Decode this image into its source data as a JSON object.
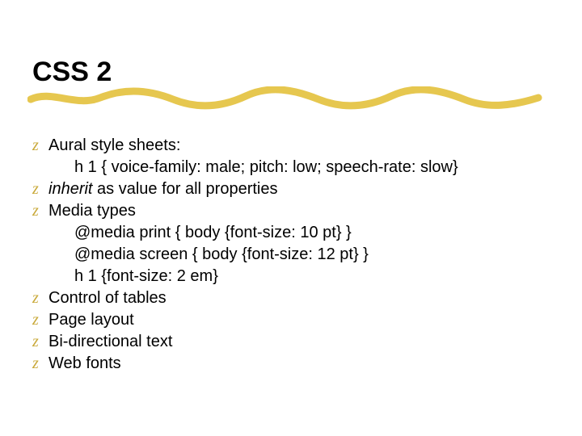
{
  "title": "CSS 2",
  "bullet_glyph": "z",
  "items": [
    {
      "text": "Aural style sheets:",
      "sub": [
        "h 1 { voice-family: male; pitch: low; speech-rate: slow}"
      ]
    },
    {
      "prefix_italic": "inherit",
      "rest": " as value for all properties"
    },
    {
      "text": "Media types",
      "sub": [
        "@media print { body {font-size: 10 pt} }",
        "@media screen { body {font-size: 12 pt} }",
        "h 1 {font-size: 2 em}"
      ]
    },
    {
      "text": "Control of tables"
    },
    {
      "text": "Page layout"
    },
    {
      "text": "Bi-directional text"
    },
    {
      "text": "Web fonts"
    }
  ]
}
